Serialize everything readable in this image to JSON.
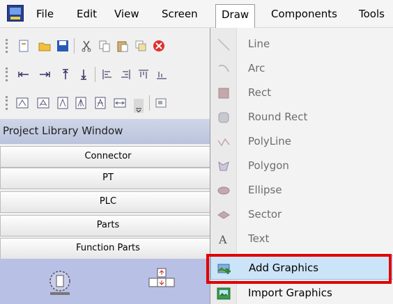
{
  "menubar": {
    "items": [
      {
        "label": "File"
      },
      {
        "label": "Edit"
      },
      {
        "label": "View"
      },
      {
        "label": "Screen"
      },
      {
        "label": "Draw"
      },
      {
        "label": "Components"
      },
      {
        "label": "Tools"
      }
    ]
  },
  "library": {
    "title": "Project Library Window",
    "buttons": [
      {
        "label": "Connector"
      },
      {
        "label": "PT"
      },
      {
        "label": "PLC"
      },
      {
        "label": "Parts"
      },
      {
        "label": "Function Parts"
      }
    ]
  },
  "draw_menu": {
    "items": [
      {
        "label": "Line",
        "icon": "line-icon",
        "enabled": false
      },
      {
        "label": "Arc",
        "icon": "arc-icon",
        "enabled": false
      },
      {
        "label": "Rect",
        "icon": "rect-icon",
        "enabled": false
      },
      {
        "label": "Round Rect",
        "icon": "round-rect-icon",
        "enabled": false
      },
      {
        "label": "PolyLine",
        "icon": "polyline-icon",
        "enabled": false
      },
      {
        "label": "Polygon",
        "icon": "polygon-icon",
        "enabled": false
      },
      {
        "label": "Ellipse",
        "icon": "ellipse-icon",
        "enabled": false
      },
      {
        "label": "Sector",
        "icon": "sector-icon",
        "enabled": false
      },
      {
        "label": "Text",
        "icon": "text-icon",
        "enabled": false
      },
      {
        "label": "Add Graphics",
        "icon": "add-graphics-icon",
        "enabled": true,
        "highlighted": true
      },
      {
        "label": "Import Graphics",
        "icon": "import-graphics-icon",
        "enabled": true
      }
    ]
  },
  "colors": {
    "highlight_border": "#e00000",
    "hover_background": "#cce4f7",
    "library_title_bg": "#c5cde3",
    "library_area_bg": "#b8c0e6"
  }
}
